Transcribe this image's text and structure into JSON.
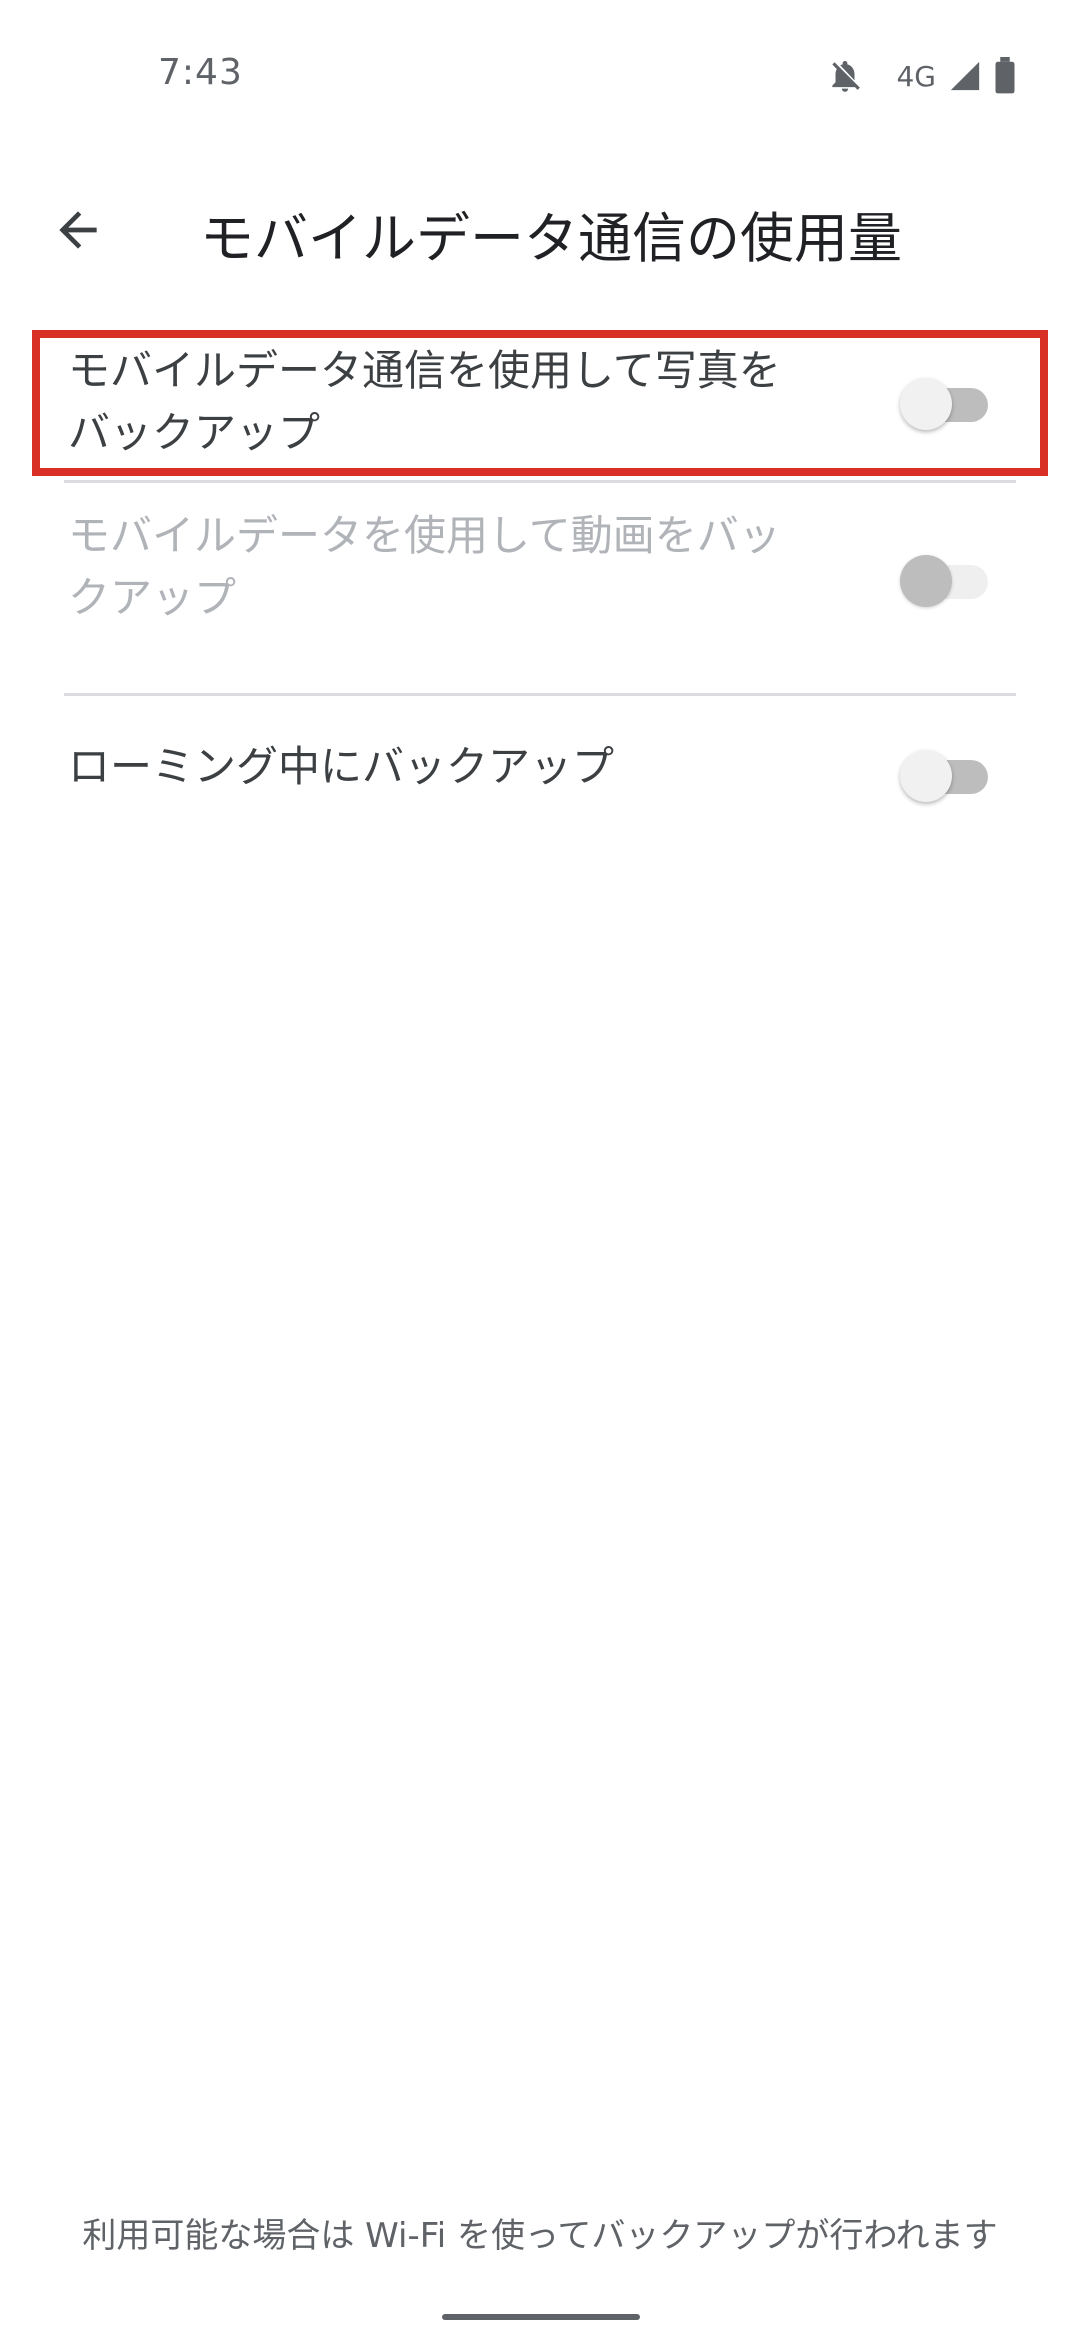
{
  "status_bar": {
    "time": "7:43",
    "network": "4G",
    "icons": [
      "notifications-off-icon",
      "signal-icon",
      "battery-icon"
    ]
  },
  "app_bar": {
    "title": "モバイルデータ通信の使用量",
    "back_icon": "arrow-back-icon"
  },
  "settings": [
    {
      "label_line1": "モバイルデータ通信を使用して写真を",
      "label_line2": "バックアップ",
      "enabled": true,
      "on": false,
      "highlighted": true
    },
    {
      "label_line1": "モバイルデータを使用して動画をバッ",
      "label_line2": "クアップ",
      "enabled": false,
      "on": false
    },
    {
      "label": "ローミング中にバックアップ",
      "enabled": true,
      "on": false
    }
  ],
  "footer_note": "利用可能な場合は Wi-Fi を使ってバックアップが行われます",
  "colors": {
    "highlight": "#d93025",
    "text_primary": "#202124",
    "text_disabled": "#b0b3b8",
    "divider": "#dadce0"
  }
}
